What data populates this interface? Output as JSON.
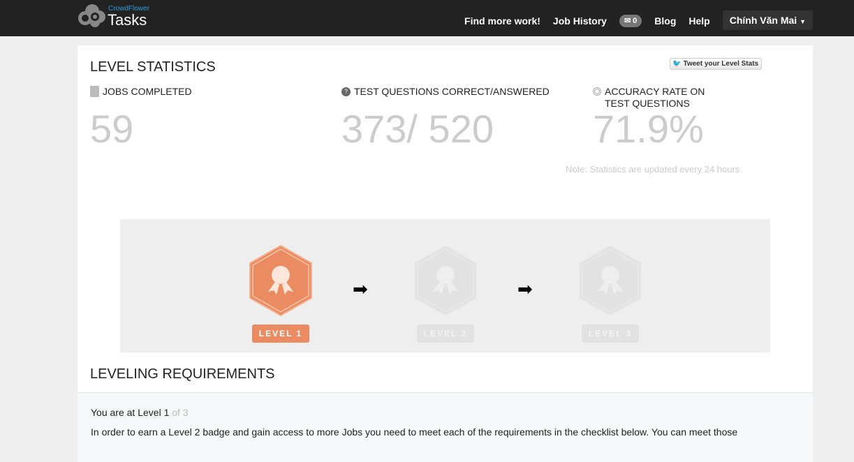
{
  "nav": {
    "brand_small": "CrowdFlower",
    "brand": "Tasks",
    "links": [
      "Find more work!",
      "Job History"
    ],
    "messages": "0",
    "blog": "Blog",
    "help": "Help",
    "user": "Chính Văn Mai"
  },
  "stats": {
    "title": "LEVEL STATISTICS",
    "tweet": "Tweet your Level Stats",
    "jobs_label": "JOBS COMPLETED",
    "jobs": "59",
    "tq_label": "TEST QUESTIONS CORRECT/ANSWERED",
    "tq": "373/ 520",
    "acc_label1": "ACCURACY RATE ON",
    "acc_label2": "TEST QUESTIONS",
    "acc": "71.9%",
    "note": "Note: Statistics are updated every 24 hours"
  },
  "levels": [
    {
      "label": "LEVEL 1",
      "color": "#eb8b62"
    },
    {
      "label": "LEVEL 2",
      "color": "#e2e2e2"
    },
    {
      "label": "LEVEL 3",
      "color": "#e2e2e2"
    }
  ],
  "requirements": {
    "title": "LEVELING REQUIREMENTS",
    "level_prefix": "You are at Level 1",
    "level_suffix": " of 3",
    "text": "In order to earn a Level 2 badge and gain access to more Jobs you need to meet each of the requirements in the checklist below. You can meet those"
  }
}
